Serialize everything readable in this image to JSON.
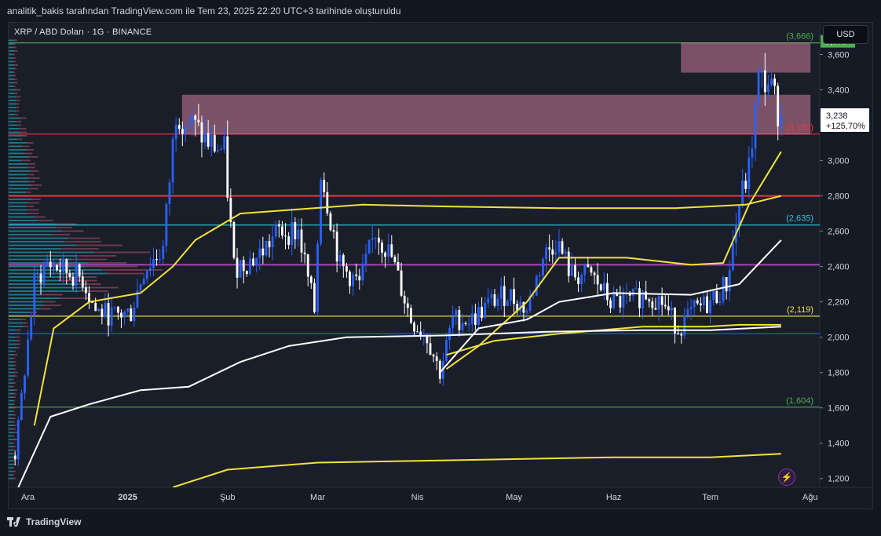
{
  "header": {
    "caption": "analitik_bakis tarafından TradingView.com ile Tem 23, 2025 22:20 UTC+3 tarihinde oluşturuldu"
  },
  "symbol": {
    "title": "XRP / ABD Doları · 1G · BINANCE"
  },
  "currency_button": "USD",
  "footer": {
    "brand": "TradingView"
  },
  "colors": {
    "up": "#2962ff",
    "down": "#ffffff",
    "yellow": "#f2e33a",
    "white": "#ffffff",
    "red": "#f23645",
    "purple": "#ab47bc",
    "blue": "#2962ff",
    "green": "#4caf50",
    "teal": "#26c6da",
    "zone": "#f48fb1"
  },
  "chart_data": {
    "type": "line",
    "title": "XRP / ABD Doları · 1G · BINANCE",
    "y_range": [
      1.15,
      3.78
    ],
    "y_ticks": [
      1.2,
      1.4,
      1.6,
      1.8,
      2.0,
      2.2,
      2.4,
      2.6,
      2.8,
      3.0,
      3.4,
      3.6
    ],
    "y_tick_labels": [
      "1,200",
      "1,400",
      "1,600",
      "1,800",
      "2,000",
      "2,200",
      "2,400",
      "2,600",
      "2,800",
      "3,000",
      "3,400",
      "3,600"
    ],
    "x_labels": [
      "Ara",
      "2025",
      "Şub",
      "Mar",
      "Nis",
      "May",
      "Haz",
      "Tem",
      "Ağu"
    ],
    "x_label_dates": [
      "2024-12-01",
      "2025-01-01",
      "2025-02-01",
      "2025-03-01",
      "2025-04-01",
      "2025-05-01",
      "2025-06-01",
      "2025-07-01",
      "2025-08-01"
    ],
    "last_price": {
      "value": 3.238,
      "label": "3,238",
      "change": "+125,70%"
    },
    "high_price": {
      "value": 3.675,
      "label": "3,675"
    },
    "price_levels": [
      {
        "value": 3.666,
        "label": "(3,666)",
        "color": "#4caf50"
      },
      {
        "value": 3.15,
        "label": "(3,150)",
        "color": "#f23645"
      },
      {
        "value": 2.8,
        "label": "",
        "color": "#f23645"
      },
      {
        "value": 2.635,
        "label": "(2,635)",
        "color": "#26c6da"
      },
      {
        "value": 2.41,
        "label": "",
        "color": "#ab47bc"
      },
      {
        "value": 2.119,
        "label": "(2,119)",
        "color": "#f2e33a"
      },
      {
        "value": 2.02,
        "label": "",
        "color": "#2962ff"
      },
      {
        "value": 1.604,
        "label": "(1,604)",
        "color": "#4caf50"
      }
    ],
    "zones": [
      {
        "from_date": "2025-01-18",
        "to_date": "2025-08-01",
        "low": 3.15,
        "high": 3.37
      },
      {
        "from_date": "2025-06-22",
        "to_date": "2025-08-01",
        "low": 3.5,
        "high": 3.665
      }
    ],
    "close_series": [
      {
        "date": "2024-11-27",
        "close": 1.33
      },
      {
        "date": "2024-12-03",
        "close": 2.3
      },
      {
        "date": "2024-12-07",
        "close": 2.42
      },
      {
        "date": "2024-12-12",
        "close": 2.38
      },
      {
        "date": "2024-12-18",
        "close": 2.33
      },
      {
        "date": "2024-12-22",
        "close": 2.15
      },
      {
        "date": "2024-12-28",
        "close": 2.12
      },
      {
        "date": "2025-01-02",
        "close": 2.14
      },
      {
        "date": "2025-01-06",
        "close": 2.38
      },
      {
        "date": "2025-01-12",
        "close": 2.5
      },
      {
        "date": "2025-01-16",
        "close": 3.28
      },
      {
        "date": "2025-01-21",
        "close": 3.2
      },
      {
        "date": "2025-01-26",
        "close": 3.1
      },
      {
        "date": "2025-01-31",
        "close": 3.05
      },
      {
        "date": "2025-02-03",
        "close": 2.4
      },
      {
        "date": "2025-02-10",
        "close": 2.45
      },
      {
        "date": "2025-02-17",
        "close": 2.6
      },
      {
        "date": "2025-02-23",
        "close": 2.6
      },
      {
        "date": "2025-02-28",
        "close": 2.15
      },
      {
        "date": "2025-03-02",
        "close": 2.95
      },
      {
        "date": "2025-03-08",
        "close": 2.4
      },
      {
        "date": "2025-03-14",
        "close": 2.3
      },
      {
        "date": "2025-03-19",
        "close": 2.6
      },
      {
        "date": "2025-03-24",
        "close": 2.45
      },
      {
        "date": "2025-03-30",
        "close": 2.1
      },
      {
        "date": "2025-04-04",
        "close": 2.0
      },
      {
        "date": "2025-04-08",
        "close": 1.8
      },
      {
        "date": "2025-04-12",
        "close": 2.1
      },
      {
        "date": "2025-04-18",
        "close": 2.1
      },
      {
        "date": "2025-04-24",
        "close": 2.2
      },
      {
        "date": "2025-04-29",
        "close": 2.25
      },
      {
        "date": "2025-05-05",
        "close": 2.15
      },
      {
        "date": "2025-05-10",
        "close": 2.45
      },
      {
        "date": "2025-05-14",
        "close": 2.55
      },
      {
        "date": "2025-05-19",
        "close": 2.35
      },
      {
        "date": "2025-05-25",
        "close": 2.35
      },
      {
        "date": "2025-05-31",
        "close": 2.2
      },
      {
        "date": "2025-06-06",
        "close": 2.2
      },
      {
        "date": "2025-06-11",
        "close": 2.25
      },
      {
        "date": "2025-06-16",
        "close": 2.2
      },
      {
        "date": "2025-06-21",
        "close": 2.05
      },
      {
        "date": "2025-06-26",
        "close": 2.15
      },
      {
        "date": "2025-07-01",
        "close": 2.2
      },
      {
        "date": "2025-07-06",
        "close": 2.3
      },
      {
        "date": "2025-07-10",
        "close": 2.75
      },
      {
        "date": "2025-07-13",
        "close": 2.95
      },
      {
        "date": "2025-07-16",
        "close": 3.45
      },
      {
        "date": "2025-07-19",
        "close": 3.45
      },
      {
        "date": "2025-07-23",
        "close": 3.238
      }
    ],
    "moving_averages": [
      {
        "color": "#f2e33a",
        "points": [
          {
            "date": "2024-12-03",
            "value": 1.5
          },
          {
            "date": "2024-12-09",
            "value": 2.05
          },
          {
            "date": "2024-12-20",
            "value": 2.2
          },
          {
            "date": "2025-01-05",
            "value": 2.25
          },
          {
            "date": "2025-01-15",
            "value": 2.4
          },
          {
            "date": "2025-01-22",
            "value": 2.55
          },
          {
            "date": "2025-02-05",
            "value": 2.7
          },
          {
            "date": "2025-02-20",
            "value": 2.72
          },
          {
            "date": "2025-03-15",
            "value": 2.75
          },
          {
            "date": "2025-04-10",
            "value": 2.74
          },
          {
            "date": "2025-05-15",
            "value": 2.73
          },
          {
            "date": "2025-06-20",
            "value": 2.73
          },
          {
            "date": "2025-07-12",
            "value": 2.75
          },
          {
            "date": "2025-07-23",
            "value": 2.8
          }
        ]
      },
      {
        "color": "#f2e33a",
        "points": [
          {
            "date": "2025-04-10",
            "value": 1.82
          },
          {
            "date": "2025-04-20",
            "value": 1.95
          },
          {
            "date": "2025-05-05",
            "value": 2.2
          },
          {
            "date": "2025-05-15",
            "value": 2.45
          },
          {
            "date": "2025-06-05",
            "value": 2.45
          },
          {
            "date": "2025-06-25",
            "value": 2.41
          },
          {
            "date": "2025-07-05",
            "value": 2.42
          },
          {
            "date": "2025-07-13",
            "value": 2.75
          },
          {
            "date": "2025-07-23",
            "value": 3.05
          }
        ]
      },
      {
        "color": "#f2e33a",
        "points": [
          {
            "date": "2025-04-10",
            "value": 1.9
          },
          {
            "date": "2025-04-25",
            "value": 1.98
          },
          {
            "date": "2025-05-15",
            "value": 2.02
          },
          {
            "date": "2025-06-10",
            "value": 2.06
          },
          {
            "date": "2025-06-30",
            "value": 2.06
          },
          {
            "date": "2025-07-10",
            "value": 2.07
          },
          {
            "date": "2025-07-23",
            "value": 2.07
          }
        ]
      },
      {
        "color": "#f2e33a",
        "points": [
          {
            "date": "2025-01-15",
            "value": 1.15
          },
          {
            "date": "2025-02-01",
            "value": 1.25
          },
          {
            "date": "2025-03-01",
            "value": 1.29
          },
          {
            "date": "2025-04-01",
            "value": 1.3
          },
          {
            "date": "2025-05-01",
            "value": 1.31
          },
          {
            "date": "2025-06-01",
            "value": 1.32
          },
          {
            "date": "2025-07-01",
            "value": 1.32
          },
          {
            "date": "2025-07-23",
            "value": 1.34
          }
        ]
      },
      {
        "color": "#ffffff",
        "points": [
          {
            "date": "2024-11-28",
            "value": 1.15
          },
          {
            "date": "2024-12-08",
            "value": 1.55
          },
          {
            "date": "2024-12-20",
            "value": 1.62
          },
          {
            "date": "2025-01-05",
            "value": 1.7
          },
          {
            "date": "2025-01-20",
            "value": 1.72
          },
          {
            "date": "2025-02-05",
            "value": 1.86
          },
          {
            "date": "2025-02-20",
            "value": 1.95
          },
          {
            "date": "2025-03-10",
            "value": 2.0
          },
          {
            "date": "2025-04-10",
            "value": 2.01
          },
          {
            "date": "2025-05-10",
            "value": 2.03
          },
          {
            "date": "2025-06-10",
            "value": 2.04
          },
          {
            "date": "2025-07-01",
            "value": 2.04
          },
          {
            "date": "2025-07-23",
            "value": 2.06
          }
        ]
      },
      {
        "color": "#ffffff",
        "points": [
          {
            "date": "2025-04-08",
            "value": 1.8
          },
          {
            "date": "2025-04-20",
            "value": 2.05
          },
          {
            "date": "2025-05-05",
            "value": 2.1
          },
          {
            "date": "2025-05-15",
            "value": 2.2
          },
          {
            "date": "2025-06-01",
            "value": 2.25
          },
          {
            "date": "2025-06-25",
            "value": 2.24
          },
          {
            "date": "2025-07-10",
            "value": 2.3
          },
          {
            "date": "2025-07-23",
            "value": 2.55
          }
        ]
      }
    ],
    "volume_profile": {
      "color_up": "#26c6da",
      "color_down": "#e06080",
      "peak_price": 2.41
    }
  }
}
